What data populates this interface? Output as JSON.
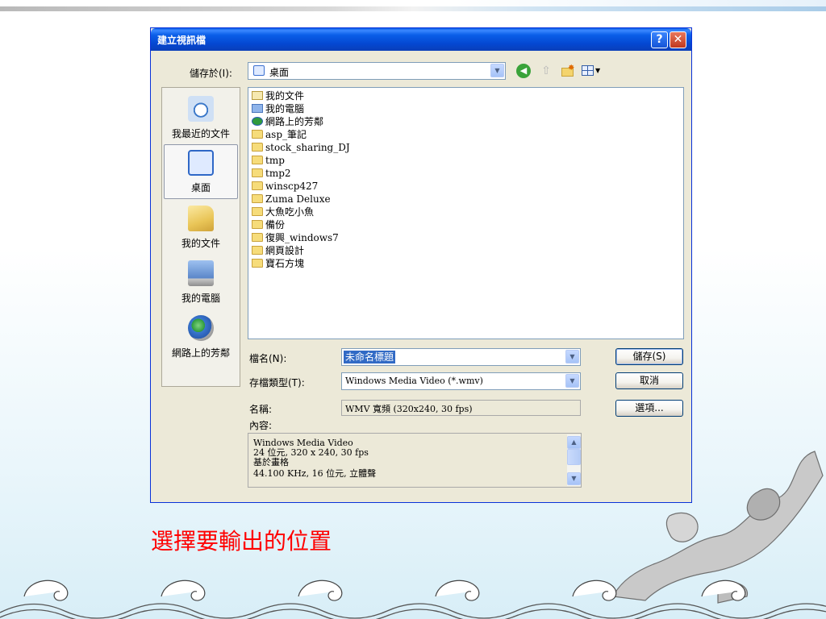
{
  "dialog": {
    "title": "建立視訊檔",
    "help_button": "?",
    "close_button": "✕",
    "save_in_label": "儲存於(I):",
    "save_in_value": "桌面"
  },
  "places": [
    {
      "label": "我最近的文件",
      "icon": "recent-documents-icon"
    },
    {
      "label": "桌面",
      "icon": "desktop-icon"
    },
    {
      "label": "我的文件",
      "icon": "my-documents-icon"
    },
    {
      "label": "我的電腦",
      "icon": "my-computer-icon"
    },
    {
      "label": "網路上的芳鄰",
      "icon": "network-places-icon"
    }
  ],
  "files": [
    {
      "name": "我的文件",
      "icon": "documents"
    },
    {
      "name": "我的電腦",
      "icon": "computer"
    },
    {
      "name": "網路上的芳鄰",
      "icon": "network"
    },
    {
      "name": "asp_筆記",
      "icon": "folder"
    },
    {
      "name": "stock_sharing_DJ",
      "icon": "folder"
    },
    {
      "name": "tmp",
      "icon": "folder"
    },
    {
      "name": "tmp2",
      "icon": "folder"
    },
    {
      "name": "winscp427",
      "icon": "folder"
    },
    {
      "name": "Zuma Deluxe",
      "icon": "folder"
    },
    {
      "name": "大魚吃小魚",
      "icon": "folder"
    },
    {
      "name": "備份",
      "icon": "folder"
    },
    {
      "name": "復興_windows7",
      "icon": "folder"
    },
    {
      "name": "網頁設計",
      "icon": "folder"
    },
    {
      "name": "寶石方塊",
      "icon": "folder"
    }
  ],
  "filename_label": "檔名(N):",
  "filename_value": "未命名標題",
  "filetype_label": "存檔類型(T):",
  "filetype_value": "Windows Media Video (*.wmv)",
  "name_label": "名稱:",
  "name_value": "WMV 寬頻 (320x240, 30 fps)",
  "content_label": "內容:",
  "description_lines": [
    "Windows Media Video",
    "24 位元, 320 x 240, 30 fps",
    "基於畫格",
    "44.100 KHz, 16 位元, 立體聲"
  ],
  "buttons": {
    "save": "儲存(S)",
    "cancel": "取消",
    "options": "選項..."
  },
  "caption": "選擇要輸出的位置"
}
